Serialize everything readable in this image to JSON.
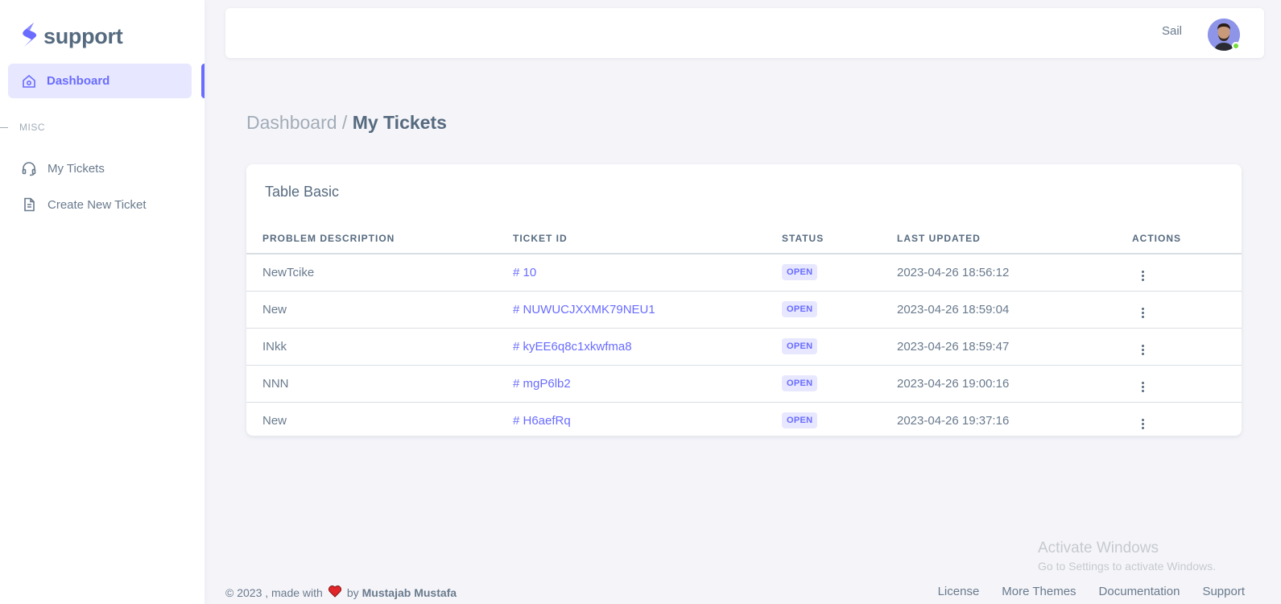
{
  "brand": {
    "name": "support",
    "accent": "#696cff"
  },
  "sidebar": {
    "active": {
      "label": "Dashboard",
      "icon": "home-icon"
    },
    "section_header": "MISC",
    "items": [
      {
        "label": "My Tickets",
        "icon": "headphones-icon"
      },
      {
        "label": "Create New Ticket",
        "icon": "file-icon"
      }
    ]
  },
  "navbar": {
    "user_name": "Sail",
    "status": "online"
  },
  "breadcrumb": {
    "parent": "Dashboard",
    "separator": " / ",
    "current": "My Tickets"
  },
  "card": {
    "title": "Table Basic",
    "columns": [
      "PROBLEM DESCRIPTION",
      "TICKET ID",
      "STATUS",
      "LAST UPDATED",
      "ACTIONS"
    ],
    "rows": [
      {
        "description": "NewTcike",
        "ticket_id": "# 10",
        "status": "OPEN",
        "updated": "2023-04-26 18:56:12"
      },
      {
        "description": "New",
        "ticket_id": "# NUWUCJXXMK79NEU1",
        "status": "OPEN",
        "updated": "2023-04-26 18:59:04"
      },
      {
        "description": "INkk",
        "ticket_id": "# kyEE6q8c1xkwfma8",
        "status": "OPEN",
        "updated": "2023-04-26 18:59:47"
      },
      {
        "description": "NNN",
        "ticket_id": "# mgP6lb2",
        "status": "OPEN",
        "updated": "2023-04-26 19:00:16"
      },
      {
        "description": "New",
        "ticket_id": "# H6aefRq",
        "status": "OPEN",
        "updated": "2023-04-26 19:37:16"
      }
    ]
  },
  "watermark": {
    "title": "Activate Windows",
    "subtitle": "Go to Settings to activate Windows."
  },
  "footer": {
    "prefix": "© 2023 , made with",
    "by": "by",
    "author": "Mustajab Mustafa",
    "links": [
      "License",
      "More Themes",
      "Documentation",
      "Support"
    ]
  }
}
